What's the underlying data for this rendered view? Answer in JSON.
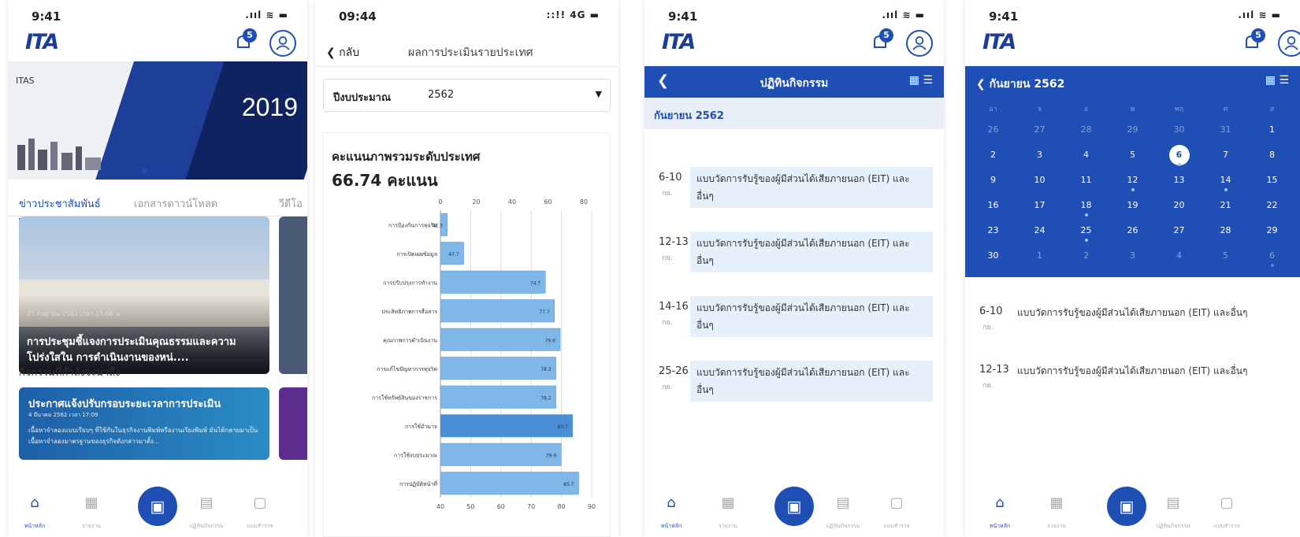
{
  "common": {
    "time_a": "9:41",
    "time_b": "09:44",
    "signal": "📶 ᯤ ▬",
    "signal_4g": "::!! 4G ▬",
    "logo": "ITA",
    "badge": "5",
    "nav": {
      "home": "หน้าหลัก",
      "report": "รายงาน",
      "calendar": "ปฏิทินกิจกรรม",
      "survey": "แบบสำรวจ"
    }
  },
  "phone1": {
    "banner_brand": "ITAS",
    "banner_year": "2019",
    "tabs": [
      "ข่าวประชาสัมพันธ์",
      "เอกสารดาวน์โหลด",
      "วีดีโอ"
    ],
    "news_date": "27 กันยายน 2561 เวลา 15:06 น.",
    "news_title": "การประชุมชี้แจงการประเมินคุณธรรมและความโปร่งใสใน การดำเนินงานของหน่....",
    "section_title": "กิจกรรมที่กำลังจะมาถึง",
    "activity_title": "ประกาศแจ้งปรับกรอบระยะเวลาการประเมิน",
    "activity_date": "4 มีนาคม 2562 เวลา 17:09",
    "activity_body": "เนื้อหาจำลองแบบเรียบๆ ที่ใช้กันในธุรกิจงานพิมพ์หรืองานเรียงพิมพ์ มันได้กลายมาเป็นเนื้อหาจำลองมาตรฐานของธุรกิจดังกล่าวมาตั้ง..."
  },
  "phone2": {
    "back": "กลับ",
    "title": "ผลการประเมินรายประเทศ",
    "filter_label": "ปีงบประมาณ",
    "filter_value": "2562",
    "card_title": "คะแนนภาพรวมระดับประเทศ",
    "card_score": "66.74 คะแนน"
  },
  "phone3": {
    "bar_title": "ปฏิทินกิจกรรม",
    "month": "กันยายน 2562",
    "events": [
      {
        "day": "6-10",
        "mon": "กย.",
        "text": "แบบวัดการรับรู้ของผู้มีส่วนได้เสียภายนอก (EIT) และอื่นๆ"
      },
      {
        "day": "12-13",
        "mon": "กย.",
        "text": "แบบวัดการรับรู้ของผู้มีส่วนได้เสียภายนอก (EIT) และอื่นๆ"
      },
      {
        "day": "14-16",
        "mon": "กย.",
        "text": "แบบวัดการรับรู้ของผู้มีส่วนได้เสียภายนอก (EIT) และอื่นๆ"
      },
      {
        "day": "25-26",
        "mon": "กย.",
        "text": "แบบวัดการรับรู้ของผู้มีส่วนได้เสียภายนอก (EIT) และอื่นๆ"
      }
    ]
  },
  "phone4": {
    "month": "กันยายน 2562",
    "weekdays": [
      "อา",
      "จ",
      "อ",
      "พ",
      "พฤ",
      "ศ",
      "ส"
    ],
    "rows": [
      [
        "26",
        "27",
        "28",
        "29",
        "30",
        "31",
        "1"
      ],
      [
        "2",
        "3",
        "4",
        "5",
        "6",
        "7",
        "8"
      ],
      [
        "9",
        "10",
        "11",
        "12",
        "13",
        "14",
        "15"
      ],
      [
        "16",
        "17",
        "18",
        "19",
        "20",
        "21",
        "22"
      ],
      [
        "23",
        "24",
        "25",
        "26",
        "27",
        "28",
        "29"
      ],
      [
        "30",
        "1",
        "2",
        "3",
        "4",
        "5",
        "6"
      ]
    ],
    "events": [
      {
        "day": "6-10",
        "mon": "กย.",
        "text": "แบบวัดการรับรู้ของผู้มีส่วนได้เสียภายนอก (EIT) และอื่นๆ"
      },
      {
        "day": "12-13",
        "mon": "กย.",
        "text": "แบบวัดการรับรู้ของผู้มีส่วนได้เสียภายนอก (EIT) และอื่นๆ"
      }
    ]
  },
  "chart_data": {
    "type": "bar",
    "orientation": "horizontal",
    "categories": [
      "การป้องกันการทุจริต",
      "การเปิดเผยข้อมูล",
      "การปรับปรุงการทำงาน",
      "ประสิทธิภาพการสื่อสาร",
      "คุณภาพการดำเนินงาน",
      "การแก้ไขปัญหาการทุจริต",
      "การใช้ทรัพย์สินของราชการ",
      "การใช้อำนาจ",
      "การใช้งบประมาณ",
      "การปฏิบัติหน้าที่"
    ],
    "values": [
      42.3,
      47.7,
      74.7,
      77.7,
      79.6,
      78.2,
      78.2,
      83.7,
      79.9,
      85.7
    ],
    "xlim_top": [
      0,
      80
    ],
    "xticks_top": [
      0,
      20,
      40,
      60,
      80
    ],
    "xlim_bottom": [
      40,
      90
    ],
    "xticks_bottom": [
      40,
      50,
      60,
      70,
      80,
      90
    ],
    "bar_color": "#7fb7e8",
    "highlight_color": "#4a8fd6"
  }
}
